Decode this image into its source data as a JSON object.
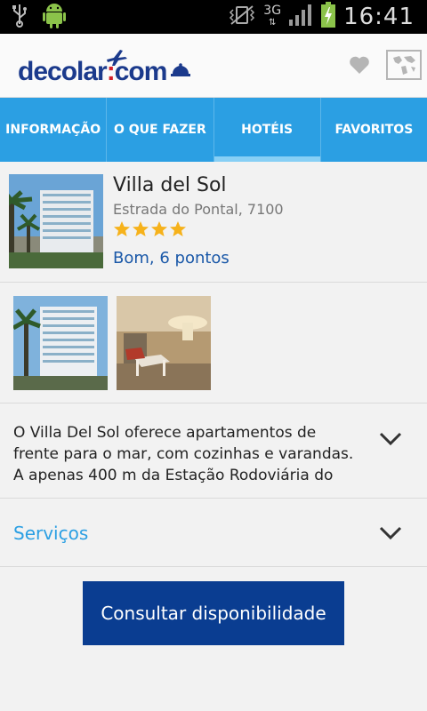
{
  "status_bar": {
    "time": "16:41",
    "network": "3G",
    "left_icons": [
      "usb-icon",
      "android-debug-icon"
    ],
    "right_icons": [
      "vibrate-off-icon",
      "network-3g-icon",
      "signal-icon",
      "battery-charging-icon"
    ]
  },
  "header": {
    "logo_text_left": "decolar",
    "logo_separator": ":",
    "logo_text_right": "com",
    "brand_color": "#1b3a8c",
    "accent_color": "#d4202b",
    "actions": [
      "heart-icon",
      "map-icon"
    ]
  },
  "tabs": [
    {
      "label": "INFORMAÇÃO",
      "active": false
    },
    {
      "label": "O QUE FAZER",
      "active": false
    },
    {
      "label": "HOTÉIS",
      "active": true
    },
    {
      "label": "FAVORITOS",
      "active": false
    }
  ],
  "hotel": {
    "name": "Villa del Sol",
    "address": "Estrada do Pontal, 7100",
    "stars": 4,
    "rating": "Bom, 6 pontos",
    "description": "O Villa Del Sol oferece apartamentos de frente para o mar, com cozinhas e varandas. A apenas 400 m da Estação Rodoviária do"
  },
  "services": {
    "label": "Serviços"
  },
  "cta": {
    "label": "Consultar disponibilidade"
  },
  "colors": {
    "tab_bg": "#2b9fe3",
    "cta_bg": "#0a3d91",
    "link": "#1a58a8"
  }
}
